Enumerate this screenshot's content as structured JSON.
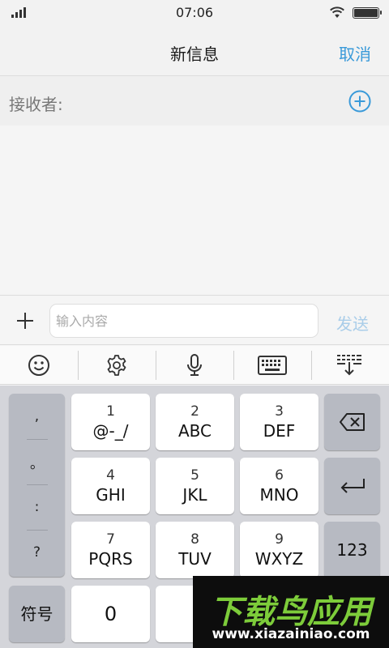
{
  "status": {
    "time": "07:06"
  },
  "nav": {
    "title": "新信息",
    "cancel": "取消"
  },
  "recipient": {
    "label": "接收者:"
  },
  "compose": {
    "placeholder": "输入内容",
    "send": "发送"
  },
  "ime_toolbar": [
    "emoji-icon",
    "settings-icon",
    "microphone-icon",
    "keyboard-icon",
    "collapse-keyboard-icon"
  ],
  "keyboard": {
    "punct": [
      ",",
      "。",
      ":",
      "?"
    ],
    "keys": [
      {
        "num": "1",
        "letters": "@-_/"
      },
      {
        "num": "2",
        "letters": "ABC"
      },
      {
        "num": "3",
        "letters": "DEF"
      },
      {
        "num": "4",
        "letters": "GHI"
      },
      {
        "num": "5",
        "letters": "JKL"
      },
      {
        "num": "6",
        "letters": "MNO"
      },
      {
        "num": "7",
        "letters": "PQRS"
      },
      {
        "num": "8",
        "letters": "TUV"
      },
      {
        "num": "9",
        "letters": "WXYZ"
      }
    ],
    "symbols": "符号",
    "zero": "0",
    "numbers": "123"
  },
  "watermark": {
    "brand": "下载鸟应用",
    "url": "www.xiazainiao.com"
  },
  "colors": {
    "accent": "#3a9ad9",
    "send_disabled": "#a9cde9",
    "keyboard_bg": "#d4d5da",
    "watermark_green": "#7dcc3a"
  }
}
